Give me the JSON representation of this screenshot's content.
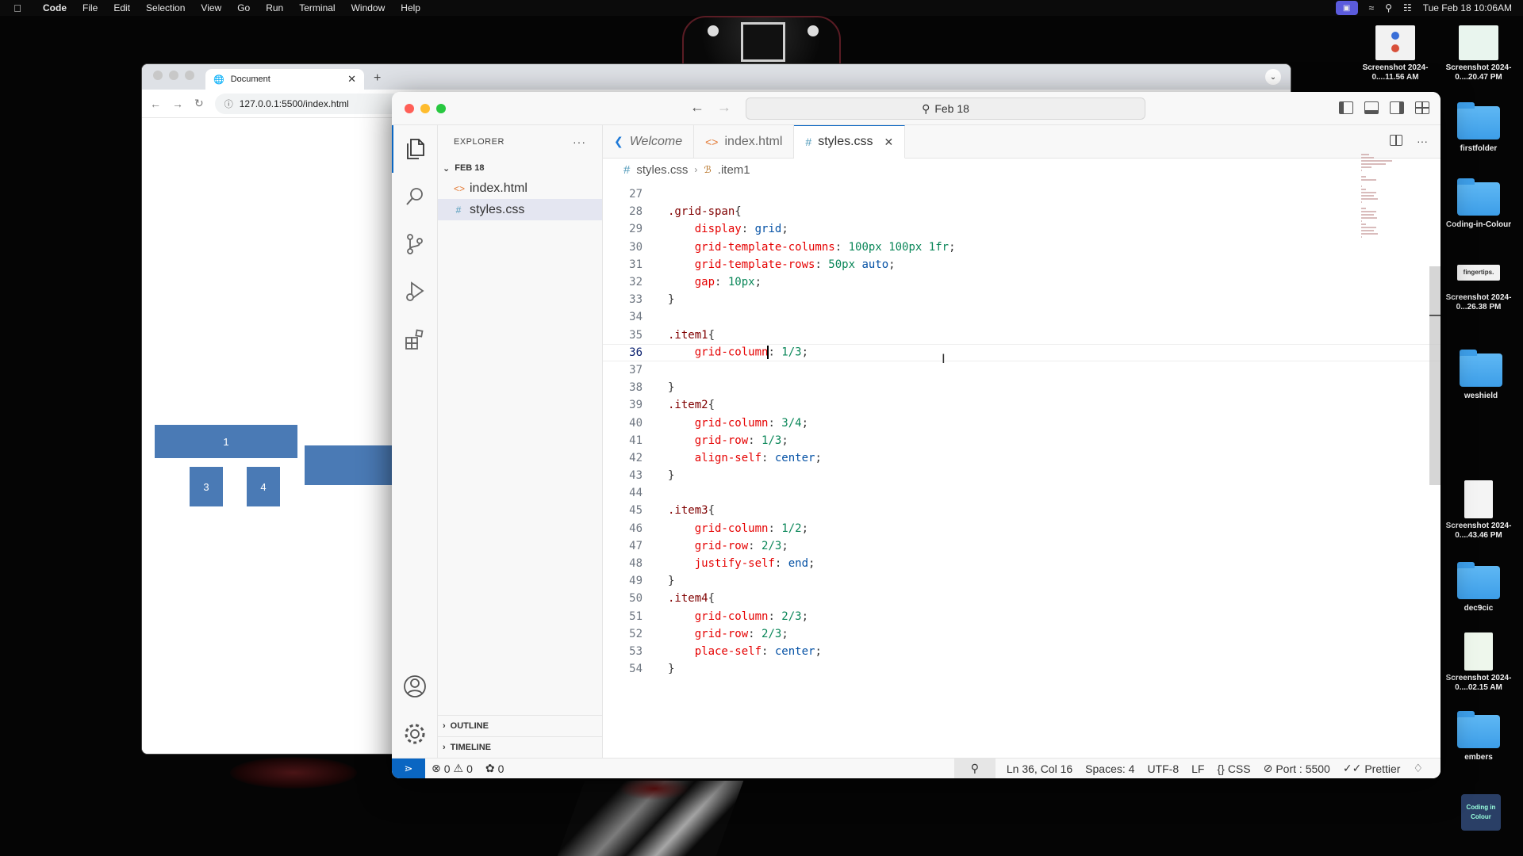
{
  "menubar": {
    "app": "Code",
    "items": [
      "File",
      "Edit",
      "Selection",
      "View",
      "Go",
      "Run",
      "Terminal",
      "Window",
      "Help"
    ],
    "clock": "Tue Feb 18  10:06AM"
  },
  "desktop": {
    "icons": [
      {
        "label": "Screenshot 2024-0....11.56 AM",
        "kind": "thumb"
      },
      {
        "label": "Screenshot 2024-0....20.47 PM",
        "kind": "thumb"
      },
      {
        "label": "firstfolder",
        "kind": "folder"
      },
      {
        "label": "Coding-in-Colour",
        "kind": "folder"
      },
      {
        "label": "Screenshot 2024-0...26.38 PM",
        "kind": "thumb",
        "thumb_text": "fingertips."
      },
      {
        "label": "weshield",
        "kind": "folder"
      },
      {
        "label": "Screenshot 2024-0....43.46 PM",
        "kind": "doc"
      },
      {
        "label": "dec9cic",
        "kind": "folder"
      },
      {
        "label": "Screenshot 2024-0....02.15 AM",
        "kind": "doc"
      },
      {
        "label": "embers",
        "kind": "folder"
      },
      {
        "label": "",
        "kind": "logo",
        "thumb_text": "Coding in Colour"
      }
    ]
  },
  "browser": {
    "tab_title": "Document",
    "url": "127.0.0.1:5500/index.html",
    "grid_items": [
      "1",
      "",
      "3",
      "4"
    ],
    "box_color": "#4a7ab5"
  },
  "vscode": {
    "command_center": "Feb 18",
    "explorer": {
      "title": "EXPLORER",
      "folder": "FEB 18",
      "files": [
        {
          "name": "index.html",
          "icon": "<>",
          "selected": false
        },
        {
          "name": "styles.css",
          "icon": "#",
          "selected": true
        }
      ],
      "sections": [
        "OUTLINE",
        "TIMELINE"
      ]
    },
    "tabs": [
      {
        "label": "Welcome",
        "icon": "vscode-logo-icon",
        "active": false
      },
      {
        "label": "index.html",
        "icon": "html-file-icon",
        "active": false
      },
      {
        "label": "styles.css",
        "icon": "css-file-icon",
        "active": true
      }
    ],
    "breadcrumb": {
      "file": "styles.css",
      "symbol": ".item1"
    },
    "code": [
      {
        "n": "27",
        "t": ""
      },
      {
        "n": "28",
        "t": ".grid-span{"
      },
      {
        "n": "29",
        "t": "    display: grid;"
      },
      {
        "n": "30",
        "t": "    grid-template-columns: 100px 100px 1fr;"
      },
      {
        "n": "31",
        "t": "    grid-template-rows: 50px auto;"
      },
      {
        "n": "32",
        "t": "    gap: 10px;"
      },
      {
        "n": "33",
        "t": "}"
      },
      {
        "n": "34",
        "t": ""
      },
      {
        "n": "35",
        "t": ".item1{"
      },
      {
        "n": "36",
        "t": "    grid-column: 1/3;"
      },
      {
        "n": "37",
        "t": ""
      },
      {
        "n": "38",
        "t": "}"
      },
      {
        "n": "39",
        "t": ".item2{"
      },
      {
        "n": "40",
        "t": "    grid-column: 3/4;"
      },
      {
        "n": "41",
        "t": "    grid-row: 1/3;"
      },
      {
        "n": "42",
        "t": "    align-self: center;"
      },
      {
        "n": "43",
        "t": "}"
      },
      {
        "n": "44",
        "t": ""
      },
      {
        "n": "45",
        "t": ".item3{"
      },
      {
        "n": "46",
        "t": "    grid-column: 1/2;"
      },
      {
        "n": "47",
        "t": "    grid-row: 2/3;"
      },
      {
        "n": "48",
        "t": "    justify-self: end;"
      },
      {
        "n": "49",
        "t": "}"
      },
      {
        "n": "50",
        "t": ".item4{"
      },
      {
        "n": "51",
        "t": "    grid-column: 2/3;"
      },
      {
        "n": "52",
        "t": "    grid-row: 2/3;"
      },
      {
        "n": "53",
        "t": "    place-self: center;"
      },
      {
        "n": "54",
        "t": "}"
      }
    ],
    "current_line": "36",
    "status": {
      "errors": "0",
      "warnings": "0",
      "ports": "0",
      "position": "Ln 36, Col 16",
      "spaces": "Spaces: 4",
      "encoding": "UTF-8",
      "eol": "LF",
      "language": "CSS",
      "port": "Port : 5500",
      "formatter": "Prettier"
    }
  }
}
